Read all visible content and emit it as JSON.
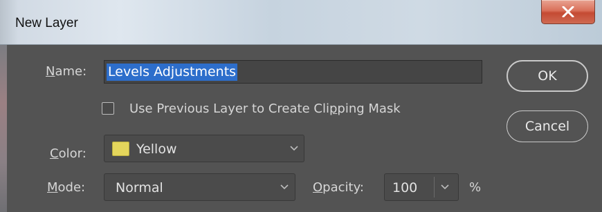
{
  "window": {
    "title": "New Layer",
    "close_label": "Close"
  },
  "form": {
    "name": {
      "label_mnemonic": "N",
      "label_rest": "ame:",
      "value": "Levels Adjustments"
    },
    "clipping": {
      "label_before": "Use Previous Layer to Create Cli",
      "label_mnemonic": "p",
      "label_after": "ping Mask",
      "checked": false
    },
    "color": {
      "label_mnemonic": "C",
      "label_rest": "olor:",
      "value": "Yellow",
      "swatch": "#e4d65c"
    },
    "mode": {
      "label_mnemonic": "M",
      "label_rest": "ode:",
      "value": "Normal"
    },
    "opacity": {
      "label_mnemonic": "O",
      "label_rest": "pacity:",
      "value": "100",
      "unit": "%"
    }
  },
  "buttons": {
    "ok": "OK",
    "cancel": "Cancel"
  },
  "colors": {
    "dialog_bg": "#535353",
    "selection": "#2d6ecb",
    "close_red": "#c44a33"
  },
  "icons": {
    "close": "close-x-icon",
    "dropdown": "chevron-down-icon"
  }
}
